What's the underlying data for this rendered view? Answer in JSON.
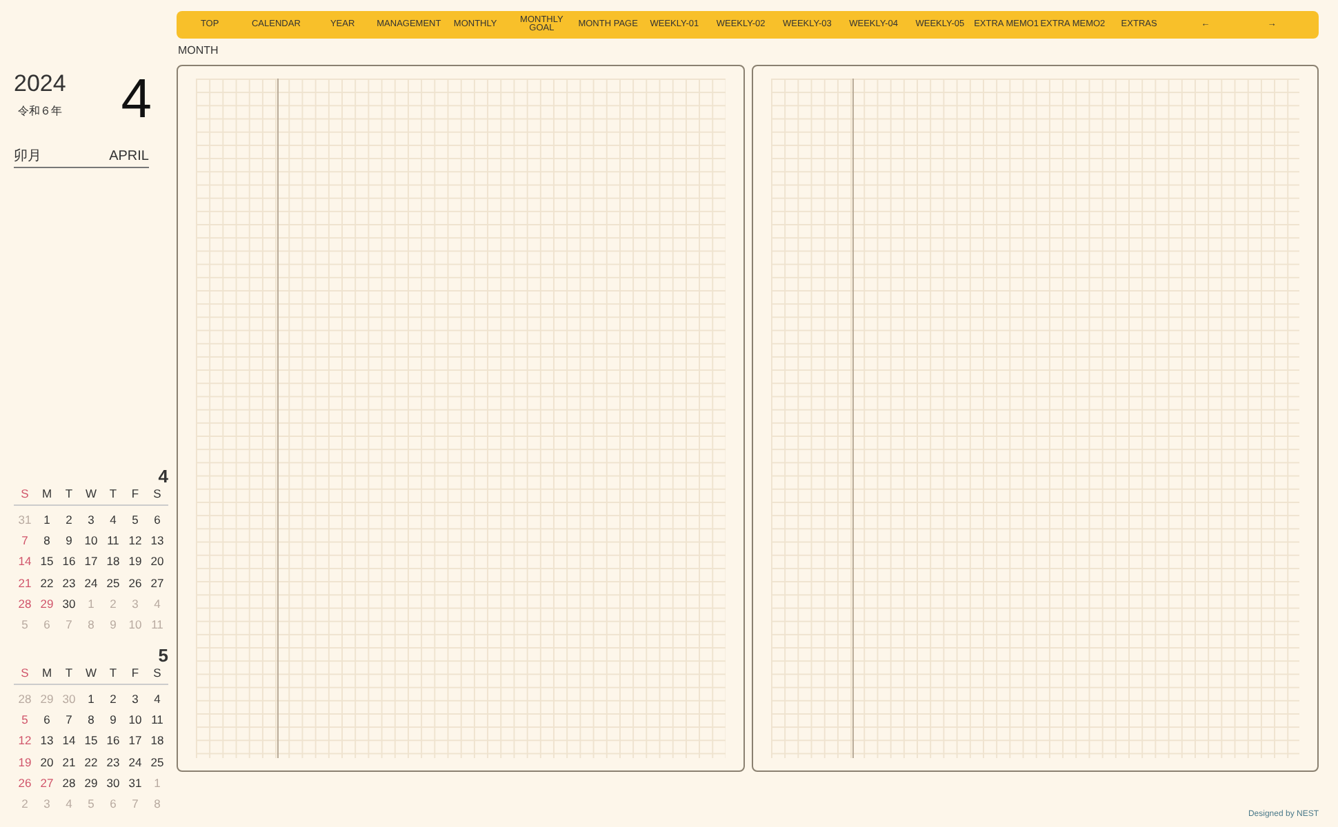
{
  "nav": [
    {
      "label": "TOP"
    },
    {
      "label": "CALENDAR"
    },
    {
      "label": "YEAR"
    },
    {
      "label": "MANAGEMENT"
    },
    {
      "label": "MONTHLY"
    },
    {
      "label": "MONTHLY\nGOAL"
    },
    {
      "label": "MONTH PAGE"
    },
    {
      "label": "WEEKLY-01"
    },
    {
      "label": "WEEKLY-02"
    },
    {
      "label": "WEEKLY-03"
    },
    {
      "label": "WEEKLY-04"
    },
    {
      "label": "WEEKLY-05"
    },
    {
      "label": "EXTRA MEMO1"
    },
    {
      "label": "EXTRA MEMO2"
    },
    {
      "label": "EXTRAS"
    },
    {
      "label": "←"
    },
    {
      "label": "→"
    }
  ],
  "page_label": "MONTH",
  "header": {
    "year": "2024",
    "era": "令和６年",
    "month_number": "4",
    "month_jp": "卯月",
    "month_en": "APRIL"
  },
  "mini_calendars": [
    {
      "month": "4",
      "weekdays": [
        "S",
        "M",
        "T",
        "W",
        "T",
        "F",
        "S"
      ],
      "weeks": [
        [
          {
            "d": "31",
            "kind": "out"
          },
          {
            "d": "1",
            "kind": "day"
          },
          {
            "d": "2",
            "kind": "day"
          },
          {
            "d": "3",
            "kind": "day"
          },
          {
            "d": "4",
            "kind": "day"
          },
          {
            "d": "5",
            "kind": "day"
          },
          {
            "d": "6",
            "kind": "day"
          }
        ],
        [
          {
            "d": "7",
            "kind": "day"
          },
          {
            "d": "8",
            "kind": "day"
          },
          {
            "d": "9",
            "kind": "day"
          },
          {
            "d": "10",
            "kind": "day"
          },
          {
            "d": "11",
            "kind": "day"
          },
          {
            "d": "12",
            "kind": "day"
          },
          {
            "d": "13",
            "kind": "day"
          }
        ],
        [
          {
            "d": "14",
            "kind": "day"
          },
          {
            "d": "15",
            "kind": "day"
          },
          {
            "d": "16",
            "kind": "day"
          },
          {
            "d": "17",
            "kind": "day"
          },
          {
            "d": "18",
            "kind": "day"
          },
          {
            "d": "19",
            "kind": "day"
          },
          {
            "d": "20",
            "kind": "day"
          }
        ],
        [
          {
            "d": "21",
            "kind": "day"
          },
          {
            "d": "22",
            "kind": "day"
          },
          {
            "d": "23",
            "kind": "day"
          },
          {
            "d": "24",
            "kind": "day"
          },
          {
            "d": "25",
            "kind": "day"
          },
          {
            "d": "26",
            "kind": "day"
          },
          {
            "d": "27",
            "kind": "day"
          }
        ],
        [
          {
            "d": "28",
            "kind": "day"
          },
          {
            "d": "29",
            "kind": "holiday"
          },
          {
            "d": "30",
            "kind": "day"
          },
          {
            "d": "1",
            "kind": "out"
          },
          {
            "d": "2",
            "kind": "out"
          },
          {
            "d": "3",
            "kind": "out"
          },
          {
            "d": "4",
            "kind": "out"
          }
        ],
        [
          {
            "d": "5",
            "kind": "out"
          },
          {
            "d": "6",
            "kind": "out"
          },
          {
            "d": "7",
            "kind": "out"
          },
          {
            "d": "8",
            "kind": "out"
          },
          {
            "d": "9",
            "kind": "out"
          },
          {
            "d": "10",
            "kind": "out"
          },
          {
            "d": "11",
            "kind": "out"
          }
        ]
      ]
    },
    {
      "month": "5",
      "weekdays": [
        "S",
        "M",
        "T",
        "W",
        "T",
        "F",
        "S"
      ],
      "weeks": [
        [
          {
            "d": "28",
            "kind": "out"
          },
          {
            "d": "29",
            "kind": "out"
          },
          {
            "d": "30",
            "kind": "out"
          },
          {
            "d": "1",
            "kind": "day"
          },
          {
            "d": "2",
            "kind": "day"
          },
          {
            "d": "3",
            "kind": "day"
          },
          {
            "d": "4",
            "kind": "day"
          }
        ],
        [
          {
            "d": "5",
            "kind": "day"
          },
          {
            "d": "6",
            "kind": "day"
          },
          {
            "d": "7",
            "kind": "day"
          },
          {
            "d": "8",
            "kind": "day"
          },
          {
            "d": "9",
            "kind": "day"
          },
          {
            "d": "10",
            "kind": "day"
          },
          {
            "d": "11",
            "kind": "day"
          }
        ],
        [
          {
            "d": "12",
            "kind": "day"
          },
          {
            "d": "13",
            "kind": "day"
          },
          {
            "d": "14",
            "kind": "day"
          },
          {
            "d": "15",
            "kind": "day"
          },
          {
            "d": "16",
            "kind": "day"
          },
          {
            "d": "17",
            "kind": "day"
          },
          {
            "d": "18",
            "kind": "day"
          }
        ],
        [
          {
            "d": "19",
            "kind": "day"
          },
          {
            "d": "20",
            "kind": "day"
          },
          {
            "d": "21",
            "kind": "day"
          },
          {
            "d": "22",
            "kind": "day"
          },
          {
            "d": "23",
            "kind": "day"
          },
          {
            "d": "24",
            "kind": "day"
          },
          {
            "d": "25",
            "kind": "day"
          }
        ],
        [
          {
            "d": "26",
            "kind": "day"
          },
          {
            "d": "27",
            "kind": "holiday"
          },
          {
            "d": "28",
            "kind": "day"
          },
          {
            "d": "29",
            "kind": "day"
          },
          {
            "d": "30",
            "kind": "day"
          },
          {
            "d": "31",
            "kind": "day"
          },
          {
            "d": "1",
            "kind": "out"
          }
        ],
        [
          {
            "d": "2",
            "kind": "out"
          },
          {
            "d": "3",
            "kind": "out"
          },
          {
            "d": "4",
            "kind": "out"
          },
          {
            "d": "5",
            "kind": "out"
          },
          {
            "d": "6",
            "kind": "out"
          },
          {
            "d": "7",
            "kind": "out"
          },
          {
            "d": "8",
            "kind": "out"
          }
        ]
      ]
    }
  ],
  "footer": "Designed by NEST"
}
